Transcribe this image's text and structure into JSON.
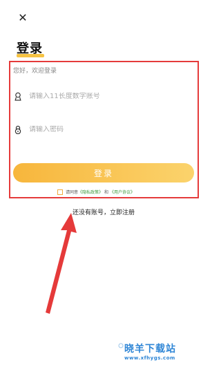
{
  "header": {
    "close_icon": "close-icon",
    "close_glyph": "✕",
    "title": "登录"
  },
  "form": {
    "welcome": "您好，欢迎登录",
    "account_placeholder": "请输入11长度数字账号",
    "account_icon": "user-icon",
    "password_placeholder": "请输入密码",
    "password_icon": "lock-icon",
    "login_label": "登录"
  },
  "agreement": {
    "prefix": "请同意",
    "privacy_link": "《隐私政策》",
    "and": "和",
    "terms_link": "《用户协议》",
    "checked": false
  },
  "register_text": "还没有账号，立即注册",
  "watermark": {
    "name": "晓羊下载站",
    "url": "www.xfhygs.com"
  },
  "colors": {
    "accent": "#f7b63c",
    "annotation": "#e53a3a",
    "link": "#3d9a3d",
    "watermark": "#2f86d6"
  }
}
